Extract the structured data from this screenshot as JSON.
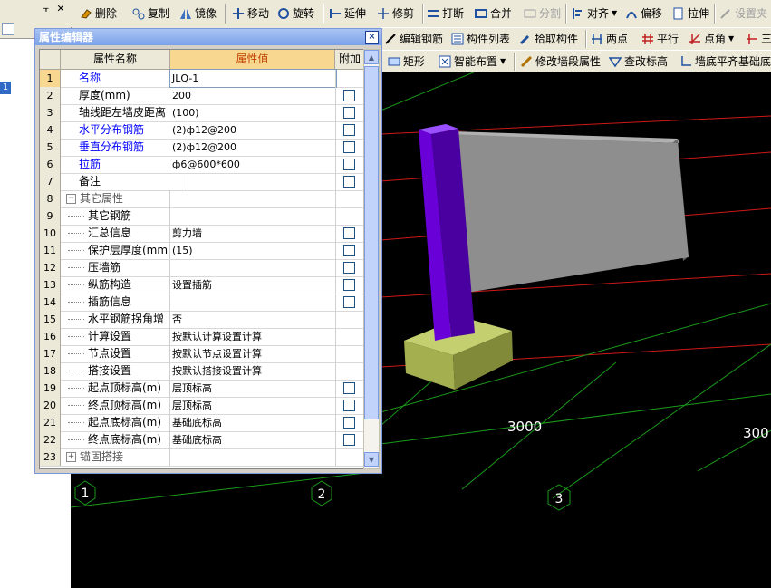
{
  "left_panel": {
    "pin_glyph": "⫟",
    "close_glyph": "✕",
    "selected_label": "1"
  },
  "toolbar1": {
    "delete": "删除",
    "copy": "复制",
    "mirror": "镜像",
    "move": "移动",
    "rotate": "旋转",
    "extend": "延伸",
    "trim": "修剪",
    "break": "打断",
    "merge": "合并",
    "split": "分割",
    "align": "对齐",
    "offset": "偏移",
    "stretch": "拉伸",
    "set_arch": "设置夹"
  },
  "toolbar2": {
    "edit_rebar": "编辑钢筋",
    "member_list": "构件列表",
    "pick_member": "拾取构件",
    "two_points": "两点",
    "parallel": "平行",
    "point_angle": "点角",
    "three": "三"
  },
  "toolbar3": {
    "rect": "矩形",
    "smart_layout": "智能布置",
    "modify_wall_attr": "修改墙段属性",
    "check_elev": "查改标高",
    "wall_bottom_flush": "墙底平齐基础底"
  },
  "property_editor": {
    "title": "属性编辑器",
    "close_glyph": "×",
    "headers": {
      "name": "属性名称",
      "value": "属性值",
      "add": "附加"
    },
    "rows": [
      {
        "num": "1",
        "name": "名称",
        "value": "JLQ-1",
        "style": "blue",
        "check": false,
        "type": "plain"
      },
      {
        "num": "2",
        "name": "厚度(mm)",
        "value": "200",
        "style": "",
        "check": true,
        "type": "plain"
      },
      {
        "num": "3",
        "name": "轴线距左墙皮距离",
        "value": "(100)",
        "style": "",
        "check": true,
        "type": "plain"
      },
      {
        "num": "4",
        "name": "水平分布钢筋",
        "value": "(2)ф12@200",
        "style": "blue",
        "check": true,
        "type": "plain"
      },
      {
        "num": "5",
        "name": "垂直分布钢筋",
        "value": "(2)ф12@200",
        "style": "blue",
        "check": true,
        "type": "plain"
      },
      {
        "num": "6",
        "name": "拉筋",
        "value": "ф6@600*600",
        "style": "blue",
        "check": true,
        "type": "plain"
      },
      {
        "num": "7",
        "name": "备注",
        "value": "",
        "style": "",
        "check": true,
        "type": "plain"
      },
      {
        "num": "8",
        "name": "其它属性",
        "value": "",
        "style": "grey",
        "check": false,
        "type": "group-open"
      },
      {
        "num": "9",
        "name": "其它钢筋",
        "value": "",
        "style": "",
        "check": false,
        "type": "child"
      },
      {
        "num": "10",
        "name": "汇总信息",
        "value": "剪力墙",
        "style": "",
        "check": true,
        "type": "child"
      },
      {
        "num": "11",
        "name": "保护层厚度(mm)",
        "value": "(15)",
        "style": "",
        "check": true,
        "type": "child"
      },
      {
        "num": "12",
        "name": "压墙筋",
        "value": "",
        "style": "",
        "check": true,
        "type": "child"
      },
      {
        "num": "13",
        "name": "纵筋构造",
        "value": "设置插筋",
        "style": "",
        "check": true,
        "type": "child"
      },
      {
        "num": "14",
        "name": "插筋信息",
        "value": "",
        "style": "",
        "check": true,
        "type": "child"
      },
      {
        "num": "15",
        "name": "水平钢筋拐角增",
        "value": "否",
        "style": "",
        "check": false,
        "type": "child"
      },
      {
        "num": "16",
        "name": "计算设置",
        "value": "按默认计算设置计算",
        "style": "",
        "check": false,
        "type": "child"
      },
      {
        "num": "17",
        "name": "节点设置",
        "value": "按默认节点设置计算",
        "style": "",
        "check": false,
        "type": "child"
      },
      {
        "num": "18",
        "name": "搭接设置",
        "value": "按默认搭接设置计算",
        "style": "",
        "check": false,
        "type": "child"
      },
      {
        "num": "19",
        "name": "起点顶标高(m)",
        "value": "层顶标高",
        "style": "",
        "check": true,
        "type": "child"
      },
      {
        "num": "20",
        "name": "终点顶标高(m)",
        "value": "层顶标高",
        "style": "",
        "check": true,
        "type": "child"
      },
      {
        "num": "21",
        "name": "起点底标高(m)",
        "value": "基础底标高",
        "style": "",
        "check": true,
        "type": "child"
      },
      {
        "num": "22",
        "name": "终点底标高(m)",
        "value": "基础底标高",
        "style": "",
        "check": true,
        "type": "child"
      },
      {
        "num": "23",
        "name": "锚固搭接",
        "value": "",
        "style": "grey",
        "check": false,
        "type": "group-closed"
      }
    ]
  },
  "viewport": {
    "dim_labels": [
      "3000",
      "300"
    ],
    "axis_labels": [
      "1",
      "2",
      "3"
    ],
    "colors": {
      "column": "#6a00d8",
      "wall": "#8e8e8e",
      "footing": "#a4b050",
      "grid_red": "#d01818",
      "grid_green": "#1a9a1a"
    }
  }
}
